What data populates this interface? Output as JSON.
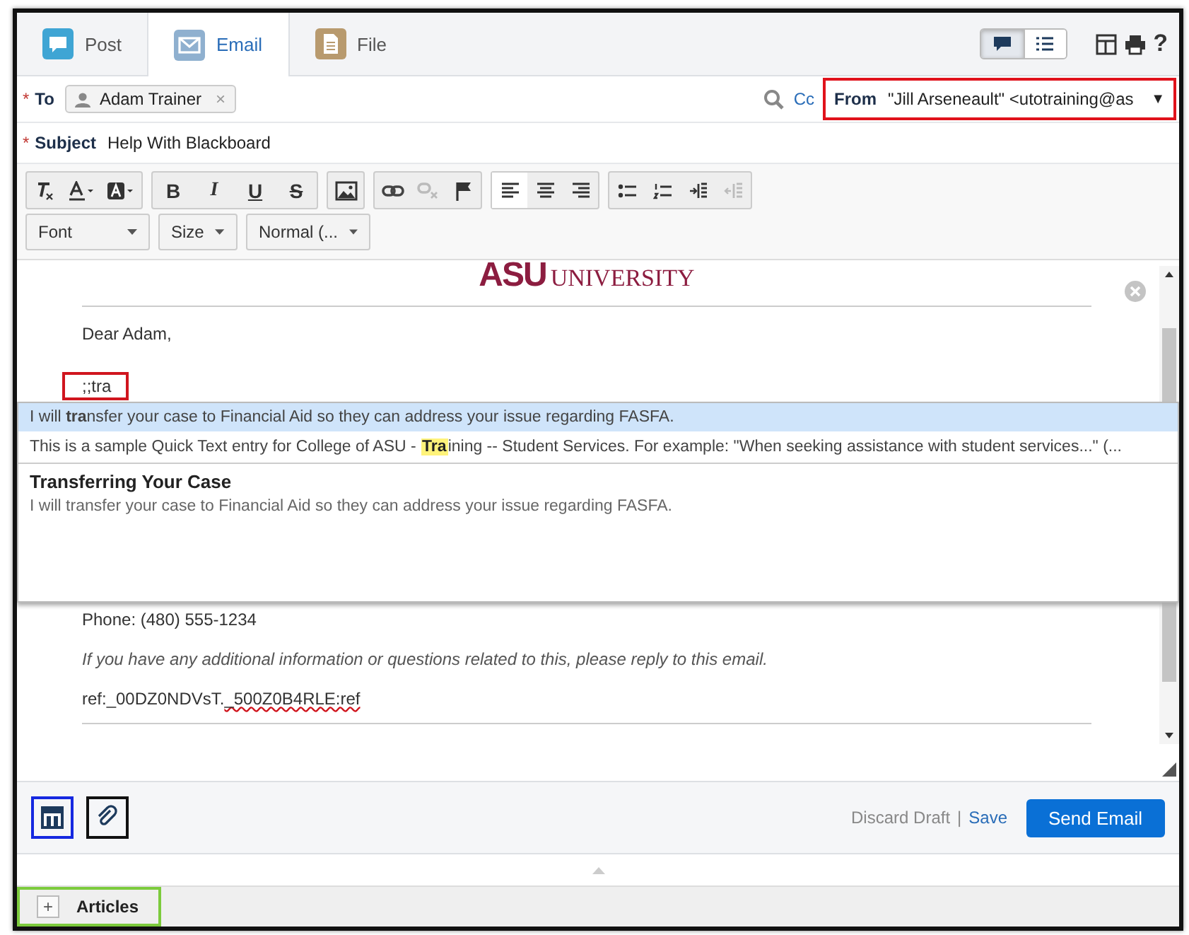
{
  "tabs": [
    {
      "label": "Post",
      "selected": false
    },
    {
      "label": "Email",
      "selected": true
    },
    {
      "label": "File",
      "selected": false
    }
  ],
  "view_toggle": [
    {
      "selected": true
    },
    {
      "selected": false
    }
  ],
  "help_label": "?",
  "to": {
    "required_mark": "*",
    "label": "To",
    "recipient": "Adam Trainer",
    "remove": "×",
    "cc_link": "Cc"
  },
  "from": {
    "label": "From",
    "value": "\"Jill Arseneault\" <utotraining@as",
    "caret": "▼"
  },
  "subject": {
    "required_mark": "*",
    "label": "Subject",
    "value": "Help With Blackboard"
  },
  "toolbar": {
    "format_buttons": [
      "B",
      "I",
      "U",
      "S"
    ],
    "dropdowns": [
      {
        "label": "Font"
      },
      {
        "label": "Size"
      },
      {
        "label": "Normal (..."
      }
    ]
  },
  "editor": {
    "logo_mark": "ASU",
    "logo_word": "UNIVERSITY",
    "greeting": "Dear Adam,",
    "typed": ";;tra",
    "phone": "Phone: (480) 555-1234",
    "note": "If you have any additional information or questions related to this, please reply to this email.",
    "ref_prefix": "ref:_00DZ0NDVsT.",
    "ref_flagged": "_500Z0B4RLE:ref"
  },
  "suggestions": [
    {
      "text": "I will **tra**nsfer your case to Financial Aid so they can address your issue regarding FASFA.",
      "selected": true
    },
    {
      "before": "This is a sample Quick Text entry for College of ASU - ",
      "match": "Tra",
      "after": "ining -- Student Services. For example: \"When seeking assistance with student services...\" (...",
      "selected": false
    }
  ],
  "preview": {
    "title": "Transferring Your Case",
    "body": "I will transfer your case to Financial Aid so they can address your issue regarding FASFA."
  },
  "footer": {
    "discard": "Discard Draft",
    "separator": "|",
    "save": "Save",
    "send": "Send Email"
  },
  "articles": {
    "expand": "+",
    "label": "Articles"
  }
}
